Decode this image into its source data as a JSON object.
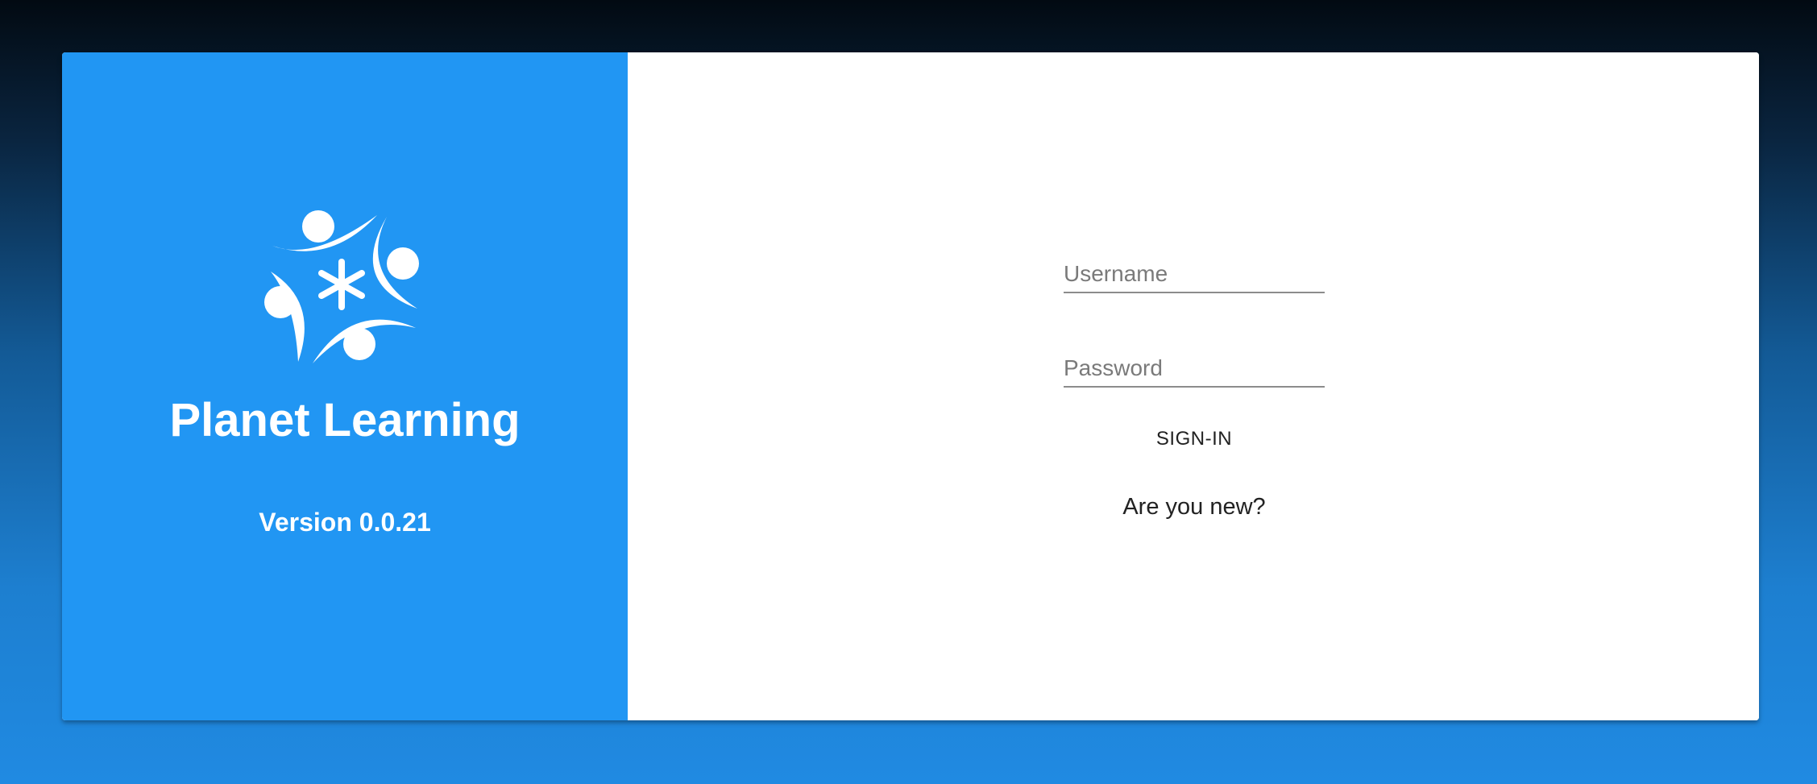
{
  "brand": {
    "title": "Planet Learning",
    "version": "Version 0.0.21",
    "logo_icon": "people-circle-asterisk-icon",
    "panel_color": "#2196f3"
  },
  "login_form": {
    "username_placeholder": "Username",
    "username_value": "",
    "password_placeholder": "Password",
    "password_value": "",
    "signin_label": "SIGN-IN",
    "new_user_link": "Are you new?"
  }
}
